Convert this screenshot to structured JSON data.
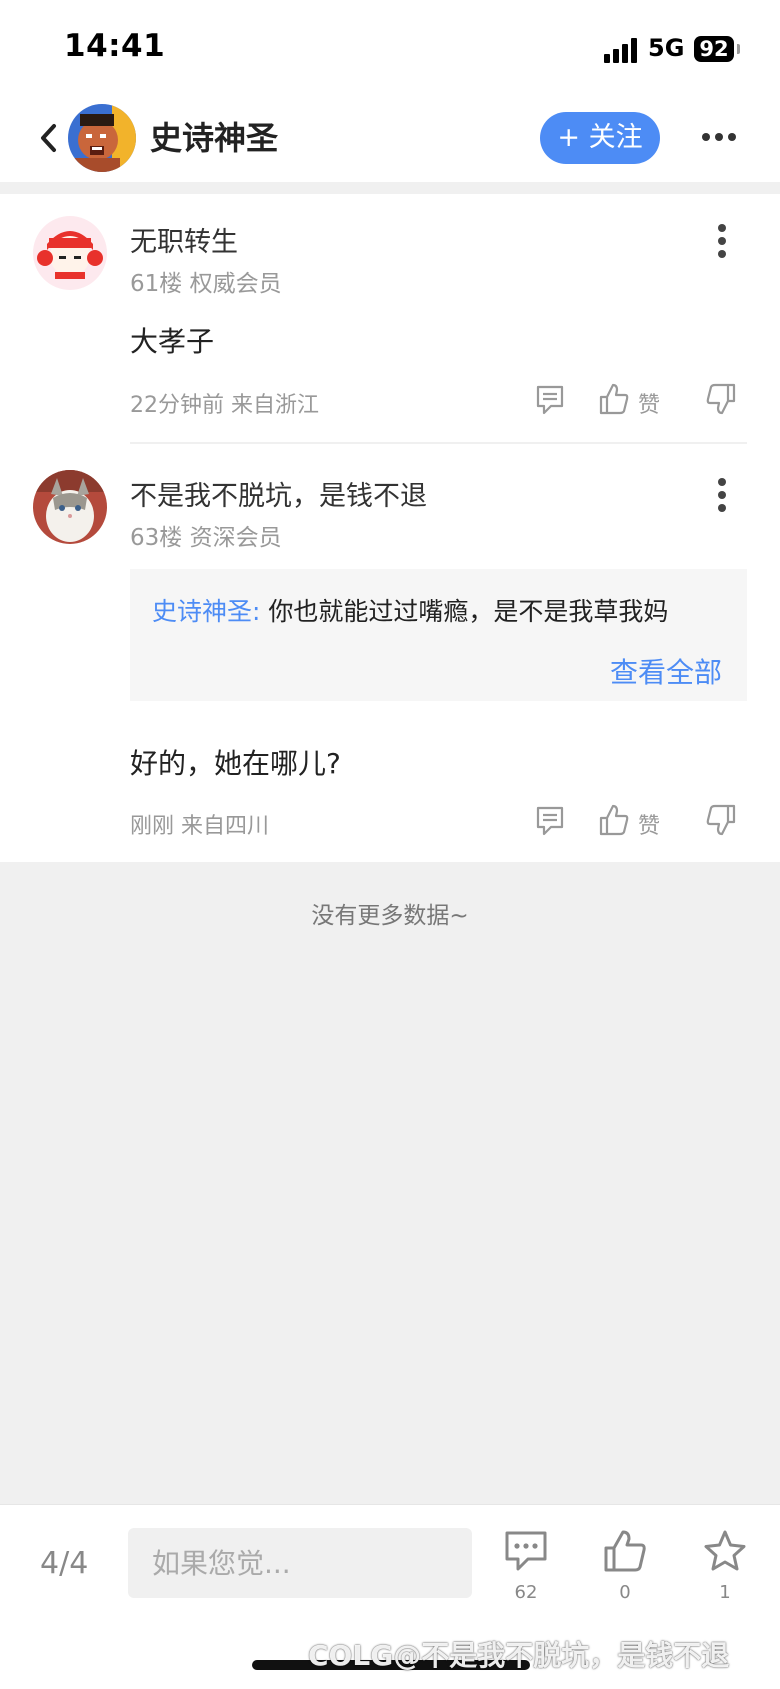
{
  "status_bar": {
    "time": "14:41",
    "network": "5G",
    "battery": "92"
  },
  "header": {
    "title": "史诗神圣",
    "follow_label": "+ 关注",
    "icons": {
      "back": "chevron-left-icon",
      "more": "more-horizontal-icon"
    },
    "accent_color": "#4d8cf5"
  },
  "posts": [
    {
      "username": "无职转生",
      "floor": "61楼",
      "rank": "权威会员",
      "content": "大孝子",
      "time": "22分钟前",
      "location": "来自浙江",
      "like_label": "赞"
    },
    {
      "username": "不是我不脱坑，是钱不退",
      "floor": "63楼",
      "rank": "资深会员",
      "quote": {
        "author": "史诗神圣:",
        "text": "你也就能过过嘴瘾，是不是我草我妈",
        "view_all": "查看全部"
      },
      "content": "好的，她在哪儿?",
      "time": "刚刚",
      "location": "来自四川",
      "like_label": "赞"
    }
  ],
  "no_more_text": "没有更多数据~",
  "bottom_bar": {
    "page_indicator": "4/4",
    "reply_placeholder": "如果您觉...",
    "comment_count": "62",
    "like_count": "0",
    "favorite_count": "1"
  },
  "watermark": "@不是我不脱坑，是钱不退",
  "watermark_logo": "COLG"
}
